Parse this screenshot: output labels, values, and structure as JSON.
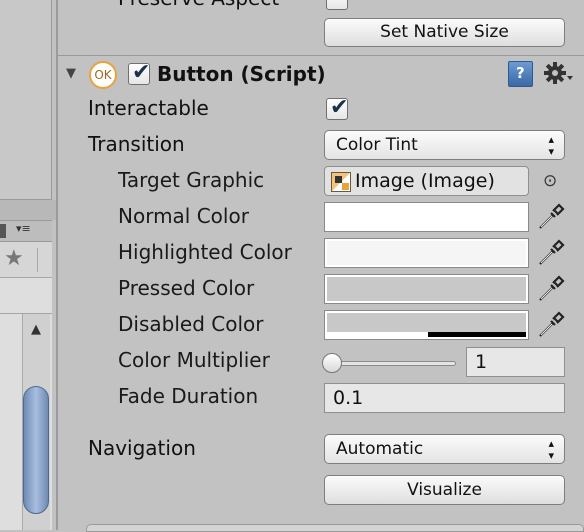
{
  "top": {
    "preserve_aspect_label": "Preserve Aspect",
    "set_native_size_label": "Set Native Size"
  },
  "component": {
    "badge": "OK",
    "title": "Button (Script)",
    "help_icon": "?"
  },
  "fields": {
    "interactable": {
      "label": "Interactable",
      "checked": true
    },
    "transition": {
      "label": "Transition",
      "value": "Color Tint"
    },
    "target_graphic": {
      "label": "Target Graphic",
      "value": "Image (Image)"
    },
    "normal_color": {
      "label": "Normal Color",
      "color": "#ffffff"
    },
    "highlighted_color": {
      "label": "Highlighted Color",
      "color": "#f5f5f5"
    },
    "pressed_color": {
      "label": "Pressed Color",
      "color": "#c8c8c8"
    },
    "disabled_color": {
      "label": "Disabled Color",
      "color": "#c8c8c8"
    },
    "color_multiplier": {
      "label": "Color Multiplier",
      "value": "1",
      "slider_fraction": 0.0
    },
    "fade_duration": {
      "label": "Fade Duration",
      "value": "0.1"
    },
    "navigation": {
      "label": "Navigation",
      "value": "Automatic"
    }
  },
  "visualize_label": "Visualize",
  "icons": {
    "star": "★",
    "foldout": "▼",
    "checkmark": "✔",
    "eyedropper": "eyedropper-icon",
    "picker": "⊙",
    "gear": "gear-icon",
    "help": "help-book-icon",
    "popup_arrows": "▴▾"
  },
  "colors": {
    "panel_bg": "#c2c2c2",
    "accent_orange": "#e8a33b",
    "help_blue": "#4a7ab8",
    "scroll_blue": "#8aa5cf"
  }
}
